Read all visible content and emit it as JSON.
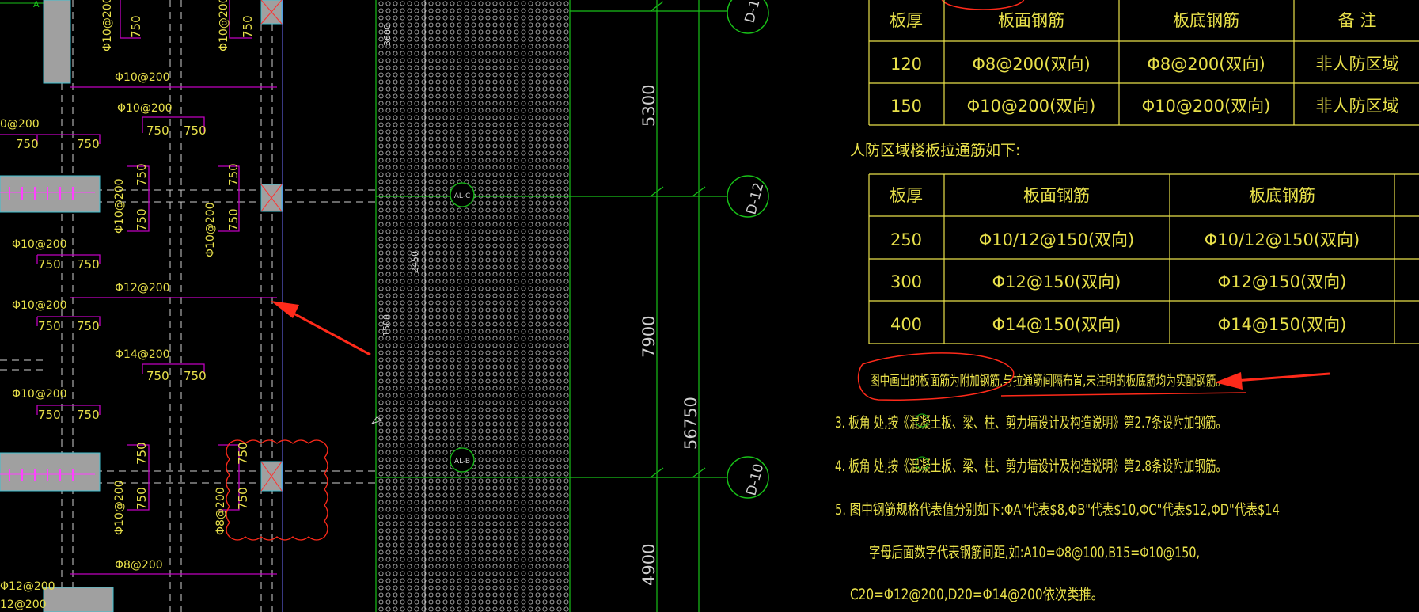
{
  "colors": {
    "background": "#000000",
    "text_yellow": "#e8e04a",
    "grid_green": "#18c018",
    "rebar_magenta": "#c000c0",
    "dim_white": "#d0d0d0",
    "markup_red": "#ff2a1a",
    "column_gray": "#a0a0a0"
  },
  "plan": {
    "top_axis_label": "A",
    "rebar_labels": [
      {
        "text": "Φ10@200"
      },
      {
        "text": "Φ10@200"
      },
      {
        "text": "Φ10@200"
      },
      {
        "text": "Φ10@200"
      },
      {
        "text": "0@200"
      },
      {
        "text": "Φ10@200"
      },
      {
        "text": "Φ10@200"
      },
      {
        "text": "Φ10@200"
      },
      {
        "text": "Φ10@200"
      },
      {
        "text": "Φ12@200"
      },
      {
        "text": "Φ10@200"
      },
      {
        "text": "Φ14@200"
      },
      {
        "text": "Φ10@200"
      },
      {
        "text": "Φ8@200"
      },
      {
        "text": "Φ8@200"
      },
      {
        "text": "Φ12@200"
      },
      {
        "text": "12@200"
      },
      {
        "text": "0"
      }
    ],
    "spacing_label": "750",
    "wall_dims": [
      "3600",
      "2450",
      "1500"
    ],
    "axis_bubbles": [
      "AL-C",
      "AL-B"
    ]
  },
  "grid": {
    "dims": [
      "5300",
      "7900",
      "56750",
      "4900"
    ],
    "bubbles": [
      "D-12",
      "D-10",
      "D-1"
    ]
  },
  "notes": {
    "table1": {
      "headers": [
        "板厚",
        "板面钢筋",
        "板底钢筋",
        "备 注"
      ],
      "rows": [
        [
          "120",
          "Φ8@200(双向)",
          "Φ8@200(双向)",
          "非人防区域"
        ],
        [
          "150",
          "Φ10@200(双向)",
          "Φ10@200(双向)",
          "非人防区域"
        ]
      ]
    },
    "section2_title": "人防区域楼板拉通筋如下:",
    "table2": {
      "headers": [
        "板厚",
        "板面钢筋",
        "板底钢筋"
      ],
      "rows": [
        [
          "250",
          "Φ10/12@150(双向)",
          "Φ10/12@150(双向)"
        ],
        [
          "300",
          "Φ12@150(双向)",
          "Φ12@150(双向)"
        ],
        [
          "400",
          "Φ14@150(双向)",
          "Φ14@150(双向)"
        ]
      ]
    },
    "note_highlight": "图中画出的板面筋为附加钢筋,与拉通筋间隔布置,未注明的板底筋均为实配钢筋。",
    "note3": "3. 板角  处,按《混凝土板、梁、柱、剪力墙设计及构造说明》第2.7条设附加钢筋。",
    "note4": "4. 板角  处,按《混凝土板、梁、柱、剪力墙设计及构造说明》第2.8条设附加钢筋。",
    "note5_line1": "5. 图中钢筋规格代表值分别如下:ΦA\"代表$8,ΦB\"代表$10,ΦC\"代表$12,ΦD\"代表$14",
    "note5_line2": "字母后面数字代表钢筋间距,如:A10=Φ8@100,B15=Φ10@150,",
    "note5_line3": "C20=Φ12@200,D20=Φ14@200依次类推。"
  }
}
